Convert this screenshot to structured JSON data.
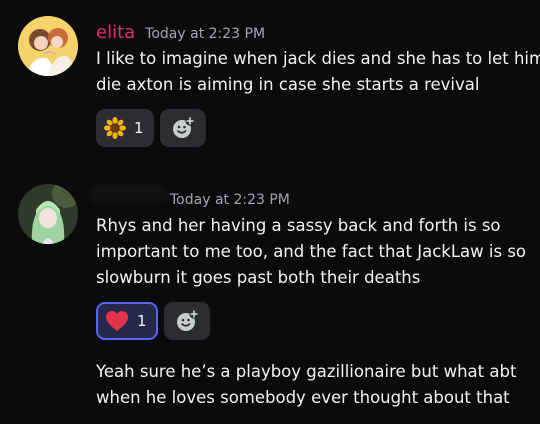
{
  "messages": [
    {
      "username": "elita",
      "timestamp": "Today at 2:23 PM",
      "lines": [
        "I like to imagine when jack dies and she has to let him",
        "die axton is aiming in case she starts a revival"
      ],
      "reaction": {
        "emoji": "sunflower-icon",
        "count": "1",
        "active": false
      }
    },
    {
      "timestamp": "Today at 2:23 PM",
      "lines": [
        "Rhys and her having a sassy back and forth is so",
        "important to me too, and the fact that JackLaw is so",
        "slowburn it goes past both their deaths"
      ],
      "reaction": {
        "emoji": "red-heart-icon",
        "count": "1",
        "active": true
      }
    },
    {
      "lines": [
        "Yeah sure he’s a playboy gazillionaire but what abt",
        "when he loves somebody ever thought about that"
      ]
    }
  ],
  "colors": {
    "background": "#0b0b0d",
    "username": "#e0306a",
    "timestamp": "#a3a6aa",
    "message_text": "#f2f3f5",
    "reaction_bg": "#2b2d31",
    "reaction_active_border": "#5865f2"
  }
}
